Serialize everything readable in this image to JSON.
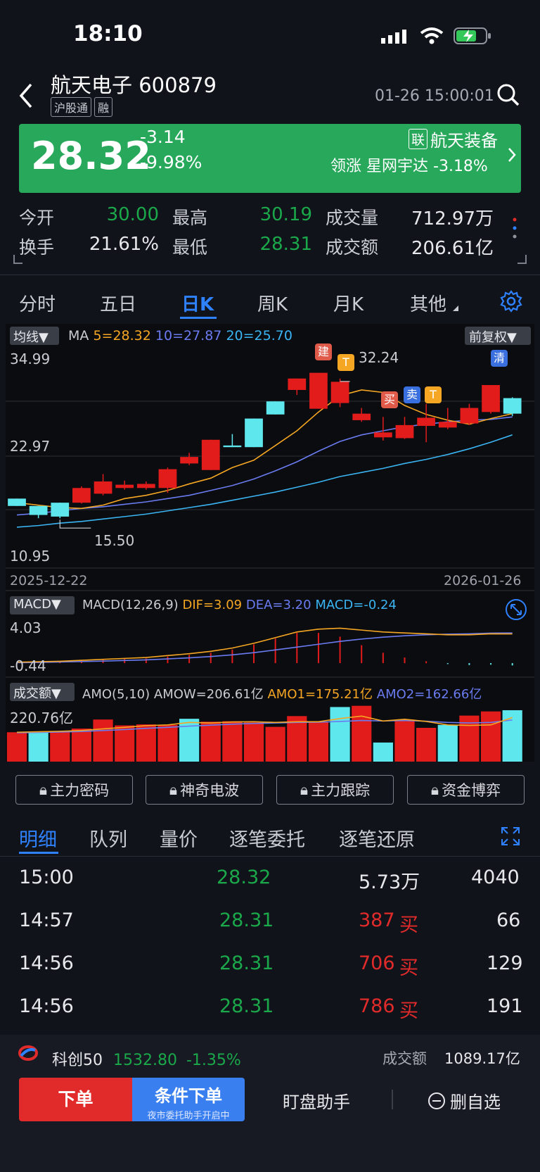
{
  "status_bar": {
    "time": "18:10"
  },
  "header": {
    "title": "航天电子 600879",
    "tags": [
      "沪股通",
      "融"
    ],
    "datetime": "01-26 15:00:01"
  },
  "quote": {
    "price": "28.32",
    "change": "-3.14",
    "change_pct": "-9.98%",
    "link_tag": "联",
    "sector": "航天装备",
    "leader_label": "领涨",
    "leader": "星网宇达 -3.18%"
  },
  "stats": [
    {
      "label": "今开",
      "value": "30.00"
    },
    {
      "label": "最高",
      "value": "30.19"
    },
    {
      "label": "成交量",
      "value": "712.97万"
    },
    {
      "label": "换手",
      "value": "21.61%"
    },
    {
      "label": "最低",
      "value": "28.31"
    },
    {
      "label": "成交额",
      "value": "206.61亿"
    }
  ],
  "period_tabs": [
    "分时",
    "五日",
    "日K",
    "周K",
    "月K",
    "其他"
  ],
  "kline": {
    "ma_toggle": "均线▼",
    "adjust": "前复权▼",
    "ma_label": "MA",
    "ma5": "5=28.32",
    "ma10": "10=27.87",
    "ma20": "20=25.70",
    "y_top": "34.99",
    "y_mid": "22.97",
    "y_bot": "10.95",
    "high_label": "32.24",
    "low_label": "15.50",
    "date_start": "2025-12-22",
    "date_end": "2026-01-26",
    "signals": [
      "建",
      "T",
      "买",
      "卖",
      "T",
      "清"
    ]
  },
  "macd": {
    "toggle": "MACD▼",
    "params": "MACD(12,26,9)",
    "dif": "DIF=3.09",
    "dea": "DEA=3.20",
    "macd": "MACD=-0.24",
    "y_top": "4.03",
    "y_bot": "-0.44"
  },
  "amo": {
    "toggle": "成交额▼",
    "params": "AMO(5,10)",
    "amow": "AMOW=206.61亿",
    "amo1": "AMO1=175.21亿",
    "amo2": "AMO2=162.66亿",
    "y_top": "220.76亿"
  },
  "chart_data": {
    "type": "candlestick",
    "x": [
      "2025-12-22",
      "...",
      "2026-01-26"
    ],
    "candles": [
      {
        "o": 17.9,
        "c": 17.0,
        "h": 17.9,
        "l": 17.0
      },
      {
        "o": 17.0,
        "c": 15.9,
        "h": 17.0,
        "l": 15.5
      },
      {
        "o": 17.4,
        "c": 15.7,
        "h": 17.4,
        "l": 15.5
      },
      {
        "o": 17.4,
        "c": 19.2,
        "h": 19.4,
        "l": 17.3
      },
      {
        "o": 18.5,
        "c": 20.0,
        "h": 20.9,
        "l": 18.3
      },
      {
        "o": 19.2,
        "c": 19.6,
        "h": 20.1,
        "l": 19.0
      },
      {
        "o": 19.2,
        "c": 19.7,
        "h": 20.0,
        "l": 19.0
      },
      {
        "o": 19.2,
        "c": 21.5,
        "h": 21.7,
        "l": 18.6
      },
      {
        "o": 22.2,
        "c": 23.0,
        "h": 23.5,
        "l": 22.0
      },
      {
        "o": 21.4,
        "c": 25.1,
        "h": 25.1,
        "l": 21.4
      },
      {
        "o": 24.4,
        "c": 24.2,
        "h": 25.8,
        "l": 24.2
      },
      {
        "o": 27.7,
        "c": 24.2,
        "h": 27.7,
        "l": 24.2
      },
      {
        "o": 29.8,
        "c": 28.2,
        "h": 29.8,
        "l": 28.2
      },
      {
        "o": 31.2,
        "c": 32.6,
        "h": 32.6,
        "l": 30.6
      },
      {
        "o": 28.9,
        "c": 33.3,
        "h": 33.3,
        "l": 28.9
      },
      {
        "o": 29.6,
        "c": 32.2,
        "h": 32.6,
        "l": 29.1
      },
      {
        "o": 27.5,
        "c": 28.3,
        "h": 29.0,
        "l": 27.3
      },
      {
        "o": 25.4,
        "c": 26.0,
        "h": 27.9,
        "l": 25.0
      },
      {
        "o": 25.3,
        "c": 26.9,
        "h": 27.9,
        "l": 25.2
      },
      {
        "o": 26.8,
        "c": 27.8,
        "h": 29.5,
        "l": 24.8
      },
      {
        "o": 26.6,
        "c": 27.3,
        "h": 29.0,
        "l": 26.4
      },
      {
        "o": 27.1,
        "c": 29.0,
        "h": 29.5,
        "l": 26.9
      },
      {
        "o": 28.5,
        "c": 31.8,
        "h": 31.8,
        "l": 28.3
      },
      {
        "o": 30.2,
        "c": 28.3,
        "h": 30.3,
        "l": 28.0
      }
    ],
    "ma5": [
      17.4,
      17.1,
      16.8,
      16.7,
      17.1,
      17.9,
      18.3,
      18.9,
      19.7,
      20.4,
      21.7,
      22.6,
      24.4,
      26.2,
      28.5,
      30.5,
      31.2,
      30.9,
      29.3,
      28.2,
      27.5,
      27.0,
      27.7,
      28.3
    ],
    "ma10": [
      15.9,
      16.1,
      16.4,
      16.7,
      16.9,
      17.2,
      17.5,
      17.9,
      18.3,
      18.9,
      19.5,
      20.3,
      21.3,
      22.4,
      23.7,
      24.9,
      25.7,
      26.2,
      26.7,
      27.0,
      27.3,
      27.5,
      27.6,
      27.9
    ],
    "ma20": [
      14.4,
      14.6,
      14.9,
      15.1,
      15.4,
      15.7,
      16.0,
      16.4,
      16.8,
      17.2,
      17.7,
      18.2,
      18.7,
      19.3,
      19.9,
      20.6,
      21.1,
      21.6,
      22.2,
      22.7,
      23.3,
      24.0,
      24.8,
      25.7
    ],
    "macd_dif": [
      0.1,
      0.15,
      0.2,
      0.3,
      0.4,
      0.5,
      0.6,
      0.8,
      1.0,
      1.25,
      1.6,
      2.1,
      2.7,
      3.3,
      3.6,
      3.7,
      3.5,
      3.3,
      3.2,
      3.1,
      3.0,
      3.0,
      3.1,
      3.09
    ],
    "macd_dea": [
      0.05,
      0.08,
      0.12,
      0.17,
      0.22,
      0.28,
      0.35,
      0.45,
      0.56,
      0.7,
      0.88,
      1.11,
      1.4,
      1.7,
      2.0,
      2.3,
      2.55,
      2.75,
      2.9,
      3.0,
      3.07,
      3.1,
      3.18,
      3.2
    ],
    "macd_hist": [
      0.1,
      0.14,
      0.16,
      0.26,
      0.36,
      0.44,
      0.5,
      0.7,
      0.88,
      1.1,
      1.44,
      1.98,
      2.6,
      3.2,
      3.2,
      2.8,
      1.9,
      1.1,
      0.6,
      0.2,
      -0.1,
      -0.2,
      -0.16,
      -0.24
    ],
    "amount": [
      120,
      120,
      125,
      135,
      172,
      148,
      152,
      150,
      175,
      163,
      165,
      160,
      142,
      186,
      162,
      223,
      228,
      78,
      172,
      138,
      150,
      188,
      205,
      210
    ],
    "amount_up": [
      false,
      true,
      false,
      false,
      false,
      false,
      false,
      false,
      true,
      false,
      false,
      false,
      false,
      false,
      false,
      true,
      false,
      true,
      false,
      false,
      true,
      false,
      false,
      true
    ],
    "amo1": [
      120,
      122,
      124,
      127,
      134,
      140,
      147,
      150,
      160,
      158,
      162,
      163,
      160,
      163,
      163,
      176,
      186,
      166,
      173,
      164,
      150,
      148,
      150,
      180
    ],
    "amo2": [
      118,
      119,
      121,
      123,
      127,
      131,
      136,
      140,
      145,
      149,
      153,
      156,
      158,
      160,
      161,
      164,
      168,
      166,
      168,
      165,
      160,
      158,
      160,
      170
    ]
  },
  "feature_buttons": [
    "主力密码",
    "神奇电波",
    "主力跟踪",
    "资金博弈"
  ],
  "detail_tabs": [
    "明细",
    "队列",
    "量价",
    "逐笔委托",
    "逐笔还原"
  ],
  "trades": [
    {
      "time": "15:00",
      "price": "28.32",
      "vol": "5.73万",
      "side": "",
      "count": "4040"
    },
    {
      "time": "14:57",
      "price": "28.31",
      "vol": "387",
      "side": "买",
      "count": "66"
    },
    {
      "time": "14:56",
      "price": "28.31",
      "vol": "706",
      "side": "买",
      "count": "129"
    },
    {
      "time": "14:56",
      "price": "28.31",
      "vol": "786",
      "side": "买",
      "count": "191"
    }
  ],
  "index_bar": {
    "name": "科创50",
    "value": "1532.80",
    "change": "-1.35%",
    "amount_label": "成交额",
    "amount": "1089.17亿"
  },
  "bottom": {
    "order": "下单",
    "cond_order": "条件下单",
    "cond_sub": "夜市委托助手开启中",
    "assistant": "盯盘助手",
    "remove": "删自选"
  },
  "colors": {
    "up": "#e12b2b",
    "down": "#1aa84a",
    "cyan": "#5ee8ee",
    "accent": "#2f82ff",
    "price_box": "#27a85a"
  }
}
